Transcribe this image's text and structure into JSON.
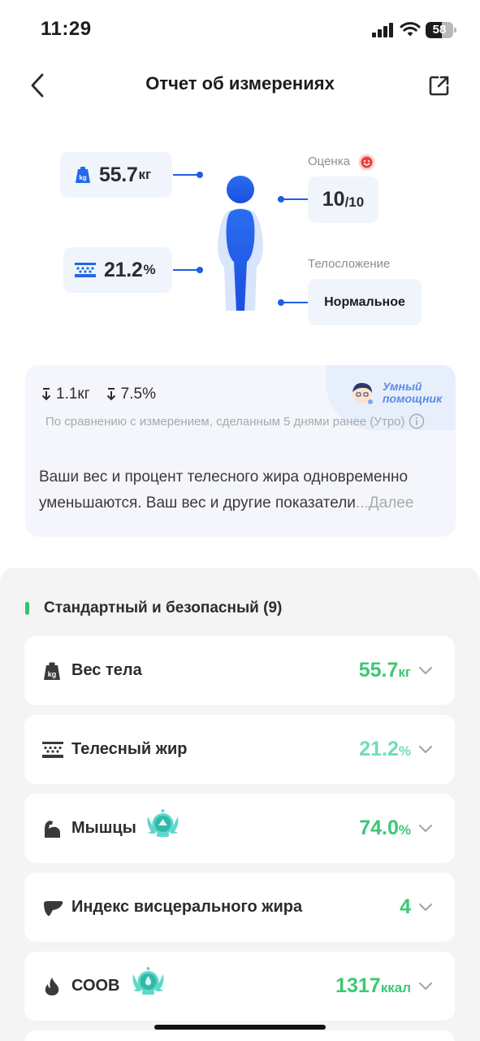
{
  "status_bar": {
    "time": "11:29",
    "battery": "58",
    "battery_level_percent": 58
  },
  "header": {
    "title": "Отчет об измерениях",
    "back_icon": "chevron-left-icon",
    "share_icon": "share-icon"
  },
  "body_summary": {
    "weight": {
      "value": "55.7",
      "unit": "кг",
      "icon": "scale-kg-icon"
    },
    "body_fat": {
      "value": "21.2",
      "unit": "%",
      "icon": "body-fat-icon"
    },
    "score": {
      "label": "Оценка",
      "value": "10",
      "max": "/10",
      "icon": "smiley-icon"
    },
    "build": {
      "label": "Телосложение",
      "value": "Нормальное"
    }
  },
  "comparison": {
    "weight_delta": "1.1кг",
    "fat_delta": "7.5%",
    "note": "По сравнению с измерением, сделанным 5 днями ранее (Утро)",
    "summary": "Ваши вес и процент телесного жира одновременно уменьшаются. Ваш вес и другие показатели",
    "more": "...Далее",
    "assistant_label": "Умный помощник"
  },
  "section": {
    "title": "Стандартный и безопасный (9)",
    "accent_color": "#34c26b",
    "items": [
      {
        "label": "Вес тела",
        "value": "55.7",
        "unit": "кг",
        "icon": "scale-kg-icon",
        "color": "#3dc874",
        "badge": false
      },
      {
        "label": "Телесный жир",
        "value": "21.2",
        "unit": "%",
        "icon": "body-fat-icon",
        "color": "#6fdfb0",
        "badge": false
      },
      {
        "label": "Мышцы",
        "value": "74.0",
        "unit": "%",
        "icon": "muscle-arm-icon",
        "color": "#3dc874",
        "badge": true
      },
      {
        "label": "Индекс висцерального жира",
        "value": "4",
        "unit": "",
        "icon": "liver-icon",
        "color": "#3dc874",
        "badge": false
      },
      {
        "label": "СООВ",
        "value": "1317",
        "unit": "ккал",
        "icon": "flame-drop-icon",
        "color": "#3dc874",
        "badge": true
      }
    ]
  }
}
